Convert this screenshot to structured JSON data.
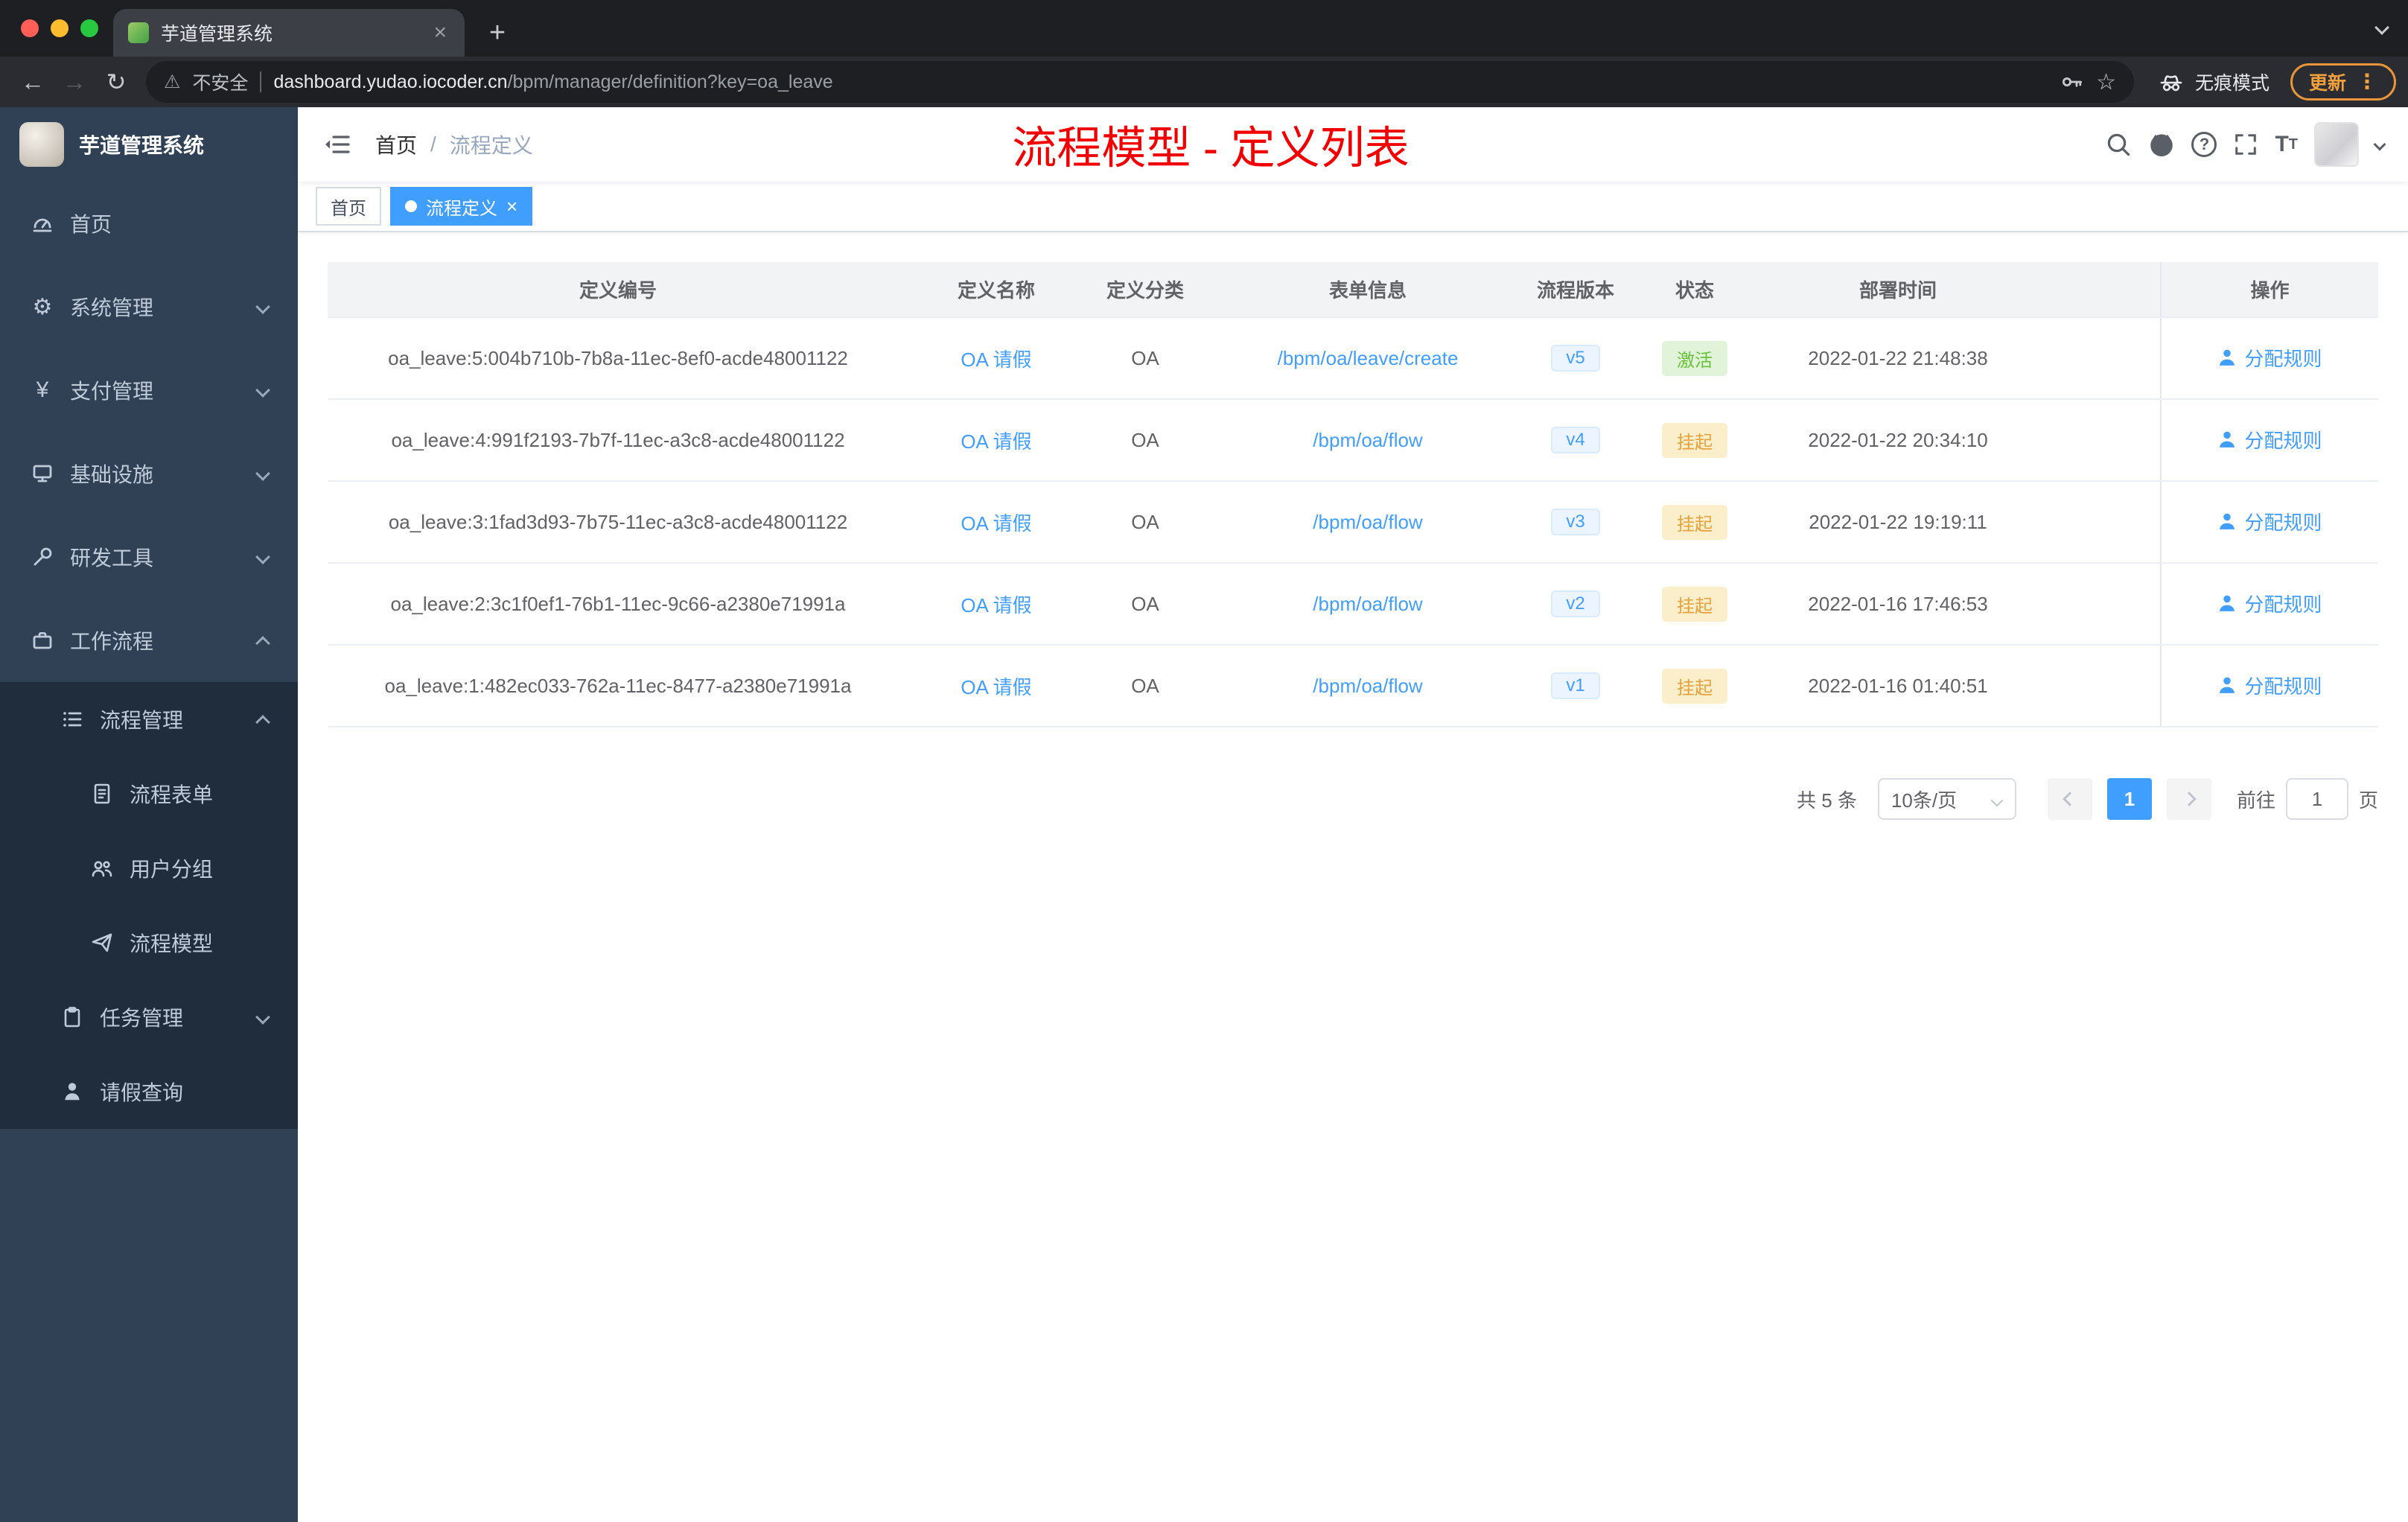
{
  "browser": {
    "tab_title": "芋道管理系统",
    "close_glyph": "×",
    "new_tab_glyph": "+",
    "back_glyph": "←",
    "forward_glyph": "→",
    "reload_glyph": "↻",
    "warning_glyph": "⚠",
    "security_label": "不安全",
    "url_host": "dashboard.yudao.iocoder.cn",
    "url_path": "/bpm/manager/definition?key=oa_leave",
    "star_glyph": "☆",
    "incognito_label": "无痕模式",
    "update_label": "更新",
    "menu_dots_glyph": "⋮"
  },
  "sidebar": {
    "title": "芋道管理系统",
    "menu": [
      {
        "label": "首页"
      },
      {
        "label": "系统管理"
      },
      {
        "label": "支付管理"
      },
      {
        "label": "基础设施"
      },
      {
        "label": "研发工具"
      },
      {
        "label": "工作流程"
      },
      {
        "label": "流程管理"
      },
      {
        "label": "流程表单"
      },
      {
        "label": "用户分组"
      },
      {
        "label": "流程模型"
      },
      {
        "label": "任务管理"
      },
      {
        "label": "请假查询"
      }
    ]
  },
  "header": {
    "breadcrumb": {
      "home": "首页",
      "separator": "/",
      "current": "流程定义"
    },
    "annotation": "流程模型 - 定义列表",
    "gear_glyph": "⚙",
    "yen_glyph": "¥",
    "help_glyph": "?"
  },
  "tags": {
    "home": "首页",
    "active": "流程定义",
    "close_glyph": "×"
  },
  "table": {
    "columns": [
      "定义编号",
      "定义名称",
      "定义分类",
      "表单信息",
      "流程版本",
      "状态",
      "部署时间",
      "操作"
    ],
    "action_label": "分配规则",
    "rows": [
      {
        "id": "oa_leave:5:004b710b-7b8a-11ec-8ef0-acde48001122",
        "name": "OA 请假",
        "category": "OA",
        "form": "/bpm/oa/leave/create",
        "version": "v5",
        "status": "激活",
        "status_type": "success",
        "deploy_time": "2022-01-22 21:48:38"
      },
      {
        "id": "oa_leave:4:991f2193-7b7f-11ec-a3c8-acde48001122",
        "name": "OA 请假",
        "category": "OA",
        "form": "/bpm/oa/flow",
        "version": "v4",
        "status": "挂起",
        "status_type": "warning",
        "deploy_time": "2022-01-22 20:34:10"
      },
      {
        "id": "oa_leave:3:1fad3d93-7b75-11ec-a3c8-acde48001122",
        "name": "OA 请假",
        "category": "OA",
        "form": "/bpm/oa/flow",
        "version": "v3",
        "status": "挂起",
        "status_type": "warning",
        "deploy_time": "2022-01-22 19:19:11"
      },
      {
        "id": "oa_leave:2:3c1f0ef1-76b1-11ec-9c66-a2380e71991a",
        "name": "OA 请假",
        "category": "OA",
        "form": "/bpm/oa/flow",
        "version": "v2",
        "status": "挂起",
        "status_type": "warning",
        "deploy_time": "2022-01-16 17:46:53"
      },
      {
        "id": "oa_leave:1:482ec033-762a-11ec-8477-a2380e71991a",
        "name": "OA 请假",
        "category": "OA",
        "form": "/bpm/oa/flow",
        "version": "v1",
        "status": "挂起",
        "status_type": "warning",
        "deploy_time": "2022-01-16 01:40:51"
      }
    ]
  },
  "pagination": {
    "total": "共 5 条",
    "page_size": "10条/页",
    "page": "1",
    "goto_label": "前往",
    "goto_value": "1",
    "goto_unit": "页"
  },
  "colors": {
    "accent": "#409eff",
    "success": "#67c23a",
    "warning": "#e6a23c",
    "annotation_red": "#f20000",
    "sidebar_bg": "#304156",
    "submenu_bg": "#1f2d3d"
  }
}
